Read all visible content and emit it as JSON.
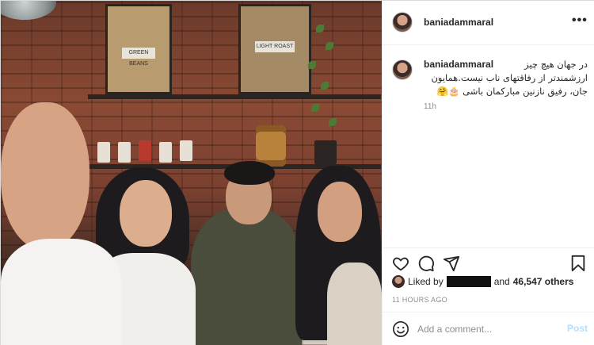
{
  "post": {
    "username": "baniadammaral",
    "caption_username": "baniadammaral",
    "caption_lines": [
      "در جهان هیچ چیز",
      "ارزشمندتر از رفاقتهای ناب نیست.همایون",
      "جان، رفیق نازنین مبارکمان باشی 🎂🤗"
    ],
    "caption_time": "11h",
    "liked_by_prefix": "Liked by",
    "liked_by_and": "and",
    "likes_count": "46,547 others",
    "posted_ago": "11 HOURS AGO",
    "comment_placeholder": "Add a comment...",
    "post_label": "Post",
    "more_icon": "•••"
  },
  "photo": {
    "poster_labels": [
      "GREEN BEANS",
      "LIGHT ROAST"
    ]
  },
  "icons": {
    "like": "heart-icon",
    "comment": "comment-icon",
    "share": "share-icon",
    "save": "bookmark-icon",
    "emoji": "emoji-icon"
  },
  "colors": {
    "post_button": "#b2dffc",
    "muted_text": "#8e8e8e",
    "primary_text": "#262626"
  }
}
